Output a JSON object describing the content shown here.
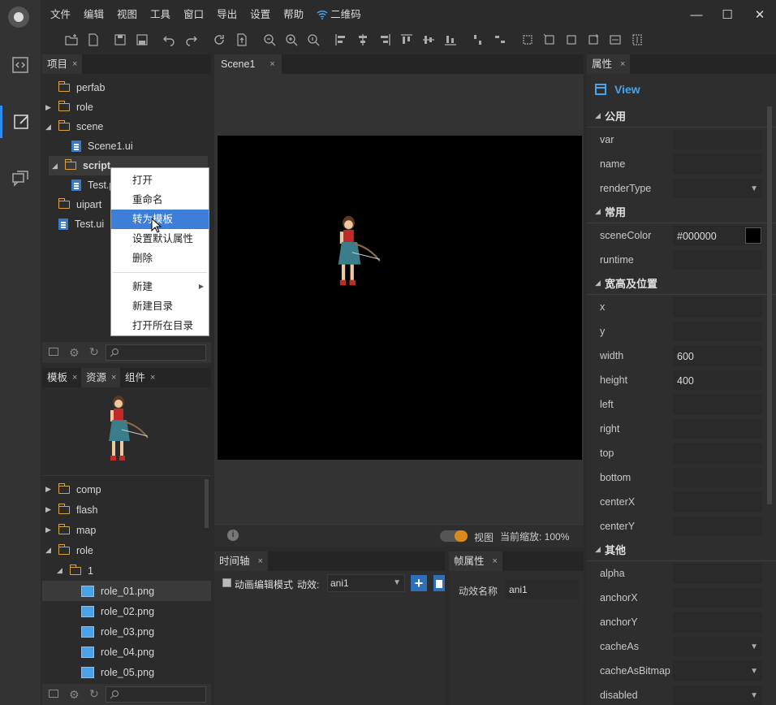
{
  "menu": [
    "文件",
    "编辑",
    "视图",
    "工具",
    "窗口",
    "导出",
    "设置",
    "帮助"
  ],
  "qr_label": "二维码",
  "window": {
    "minimize": "—",
    "maximize": "☐",
    "close": "✕"
  },
  "project_panel": {
    "tab": "项目",
    "close": "×",
    "tree": [
      {
        "label": "perfab",
        "type": "folder",
        "indent": 0,
        "arrow": ""
      },
      {
        "label": "role",
        "type": "folder",
        "indent": 0,
        "arrow": "▶"
      },
      {
        "label": "scene",
        "type": "folder",
        "indent": 0,
        "arrow": "◢"
      },
      {
        "label": "Scene1.ui",
        "type": "file",
        "indent": 1,
        "arrow": ""
      },
      {
        "label": "script",
        "type": "folder",
        "indent": 0,
        "arrow": "◢",
        "selected": true
      },
      {
        "label": "Test.p",
        "type": "file",
        "indent": 1,
        "arrow": ""
      },
      {
        "label": "uipart",
        "type": "folder",
        "indent": 0,
        "arrow": ""
      },
      {
        "label": "Test.ui",
        "type": "file",
        "indent": 0,
        "arrow": ""
      }
    ]
  },
  "context_menu": {
    "items": [
      "打开",
      "重命名",
      "转为模板",
      "设置默认属性",
      "删除"
    ],
    "items2": [
      "新建",
      "新建目录",
      "打开所在目录"
    ],
    "submenu_arrow": "▶"
  },
  "resource_panel": {
    "tabs": [
      "模板",
      "资源",
      "组件"
    ],
    "tree": [
      {
        "label": "comp",
        "type": "folder",
        "arrow": "▶",
        "indent": 0
      },
      {
        "label": "flash",
        "type": "folder",
        "arrow": "▶",
        "indent": 0
      },
      {
        "label": "map",
        "type": "folder",
        "arrow": "▶",
        "indent": 0
      },
      {
        "label": "role",
        "type": "folder",
        "arrow": "◢",
        "indent": 0
      },
      {
        "label": "1",
        "type": "folder",
        "arrow": "◢",
        "indent": 1
      },
      {
        "label": "role_01.png",
        "type": "image",
        "arrow": "",
        "indent": 2,
        "selected": true
      },
      {
        "label": "role_02.png",
        "type": "image",
        "arrow": "",
        "indent": 2
      },
      {
        "label": "role_03.png",
        "type": "image",
        "arrow": "",
        "indent": 2
      },
      {
        "label": "role_04.png",
        "type": "image",
        "arrow": "",
        "indent": 2
      },
      {
        "label": "role_05.png",
        "type": "image",
        "arrow": "",
        "indent": 2
      }
    ]
  },
  "scene": {
    "tab": "Scene1",
    "view_label": "视图",
    "zoom_label": "当前缩放: 100%"
  },
  "timeline": {
    "tab": "时间轴",
    "mode_label": "动画编辑模式",
    "effect_label": "动效:",
    "effect_value": "ani1"
  },
  "frame_props": {
    "tab": "帧属性",
    "name_label": "动效名称",
    "name_value": "ani1"
  },
  "properties": {
    "tab": "属性",
    "view_title": "View",
    "sections": [
      {
        "title": "公用",
        "rows": [
          {
            "label": "var",
            "value": "",
            "dropdown": false
          },
          {
            "label": "name",
            "value": "",
            "dropdown": false
          },
          {
            "label": "renderType",
            "value": "",
            "dropdown": true
          }
        ]
      },
      {
        "title": "常用",
        "rows": [
          {
            "label": "sceneColor",
            "value": "#000000",
            "dropdown": false,
            "swatch": "#000000"
          },
          {
            "label": "runtime",
            "value": "",
            "dropdown": false
          }
        ]
      },
      {
        "title": "宽高及位置",
        "rows": [
          {
            "label": "x",
            "value": "",
            "dropdown": false
          },
          {
            "label": "y",
            "value": "",
            "dropdown": false
          },
          {
            "label": "width",
            "value": "600",
            "dropdown": false
          },
          {
            "label": "height",
            "value": "400",
            "dropdown": false
          },
          {
            "label": "left",
            "value": "",
            "dropdown": false
          },
          {
            "label": "right",
            "value": "",
            "dropdown": false
          },
          {
            "label": "top",
            "value": "",
            "dropdown": false
          },
          {
            "label": "bottom",
            "value": "",
            "dropdown": false
          },
          {
            "label": "centerX",
            "value": "",
            "dropdown": false
          },
          {
            "label": "centerY",
            "value": "",
            "dropdown": false
          }
        ]
      },
      {
        "title": "其他",
        "rows": [
          {
            "label": "alpha",
            "value": "",
            "dropdown": false
          },
          {
            "label": "anchorX",
            "value": "",
            "dropdown": false
          },
          {
            "label": "anchorY",
            "value": "",
            "dropdown": false
          },
          {
            "label": "cacheAs",
            "value": "",
            "dropdown": true
          },
          {
            "label": "cacheAsBitmap",
            "value": "",
            "dropdown": true
          },
          {
            "label": "disabled",
            "value": "",
            "dropdown": true
          }
        ]
      }
    ]
  },
  "colors": {
    "accent": "#2d8cf0",
    "highlight": "#3c7ed8",
    "folder": "#d9a441",
    "toggle": "#d98a1c"
  }
}
